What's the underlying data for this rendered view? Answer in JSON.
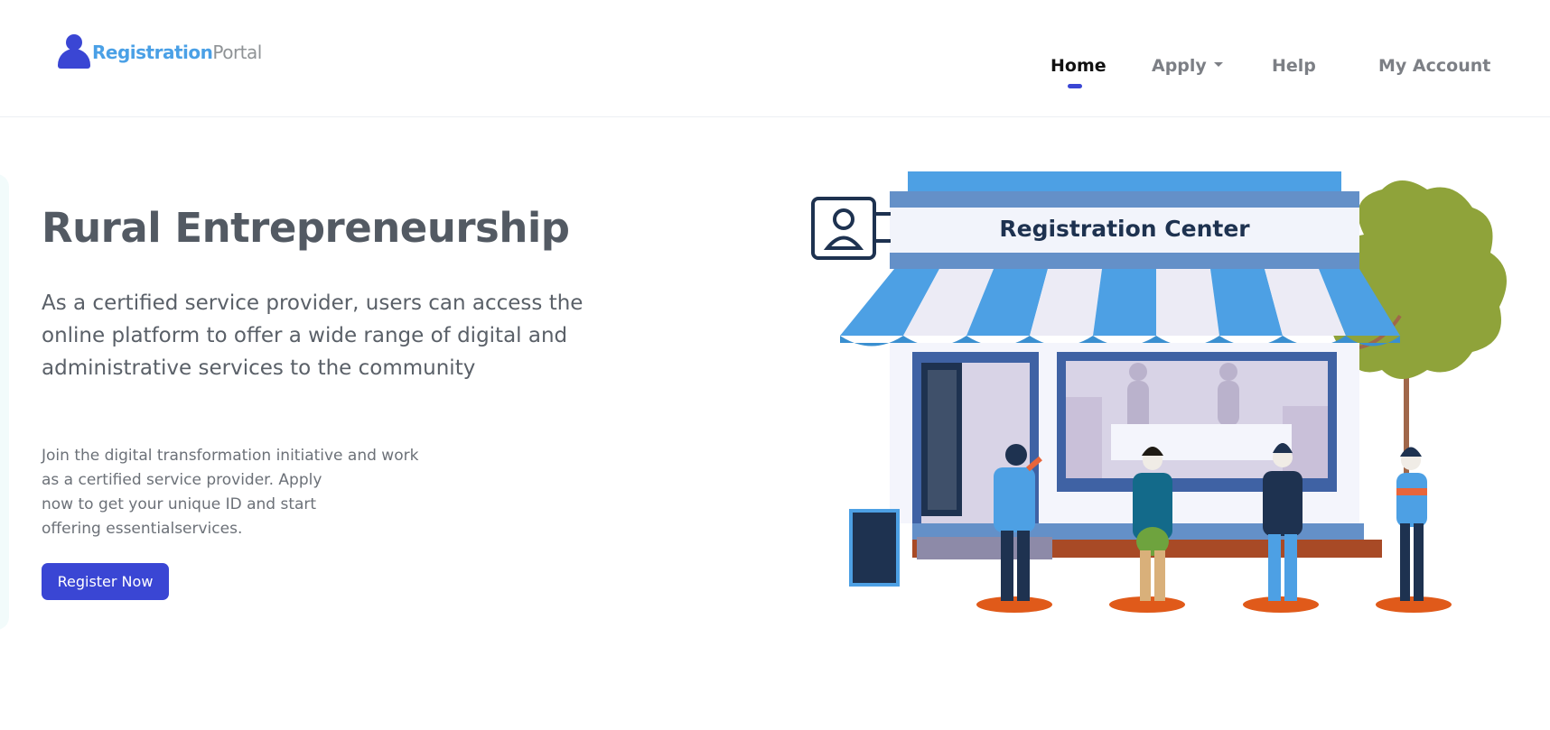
{
  "brand": {
    "part1": "Registration",
    "part2": "Portal"
  },
  "nav": {
    "home": "Home",
    "apply": "Apply",
    "help": "Help",
    "account": "My Account"
  },
  "hero": {
    "title": "Rural Entrepreneurship",
    "lead": "As a certified service provider, users can access the online platform to offer a wide range of digital and administrative services to the community",
    "sub_lines": [
      "Join the digital transformation initiative and work",
      "as a certified service provider. Apply",
      "now to get your unique ID and start",
      "offering essentialservices."
    ],
    "cta": "Register Now"
  },
  "illustration": {
    "sign_text": "Registration  Center"
  },
  "colors": {
    "accent": "#3a46d4",
    "brand_blue": "#4aa0e6",
    "awning_blue": "#4da0e4",
    "tree_green": "#8fa33a",
    "ground_orange": "#e05a1a"
  }
}
